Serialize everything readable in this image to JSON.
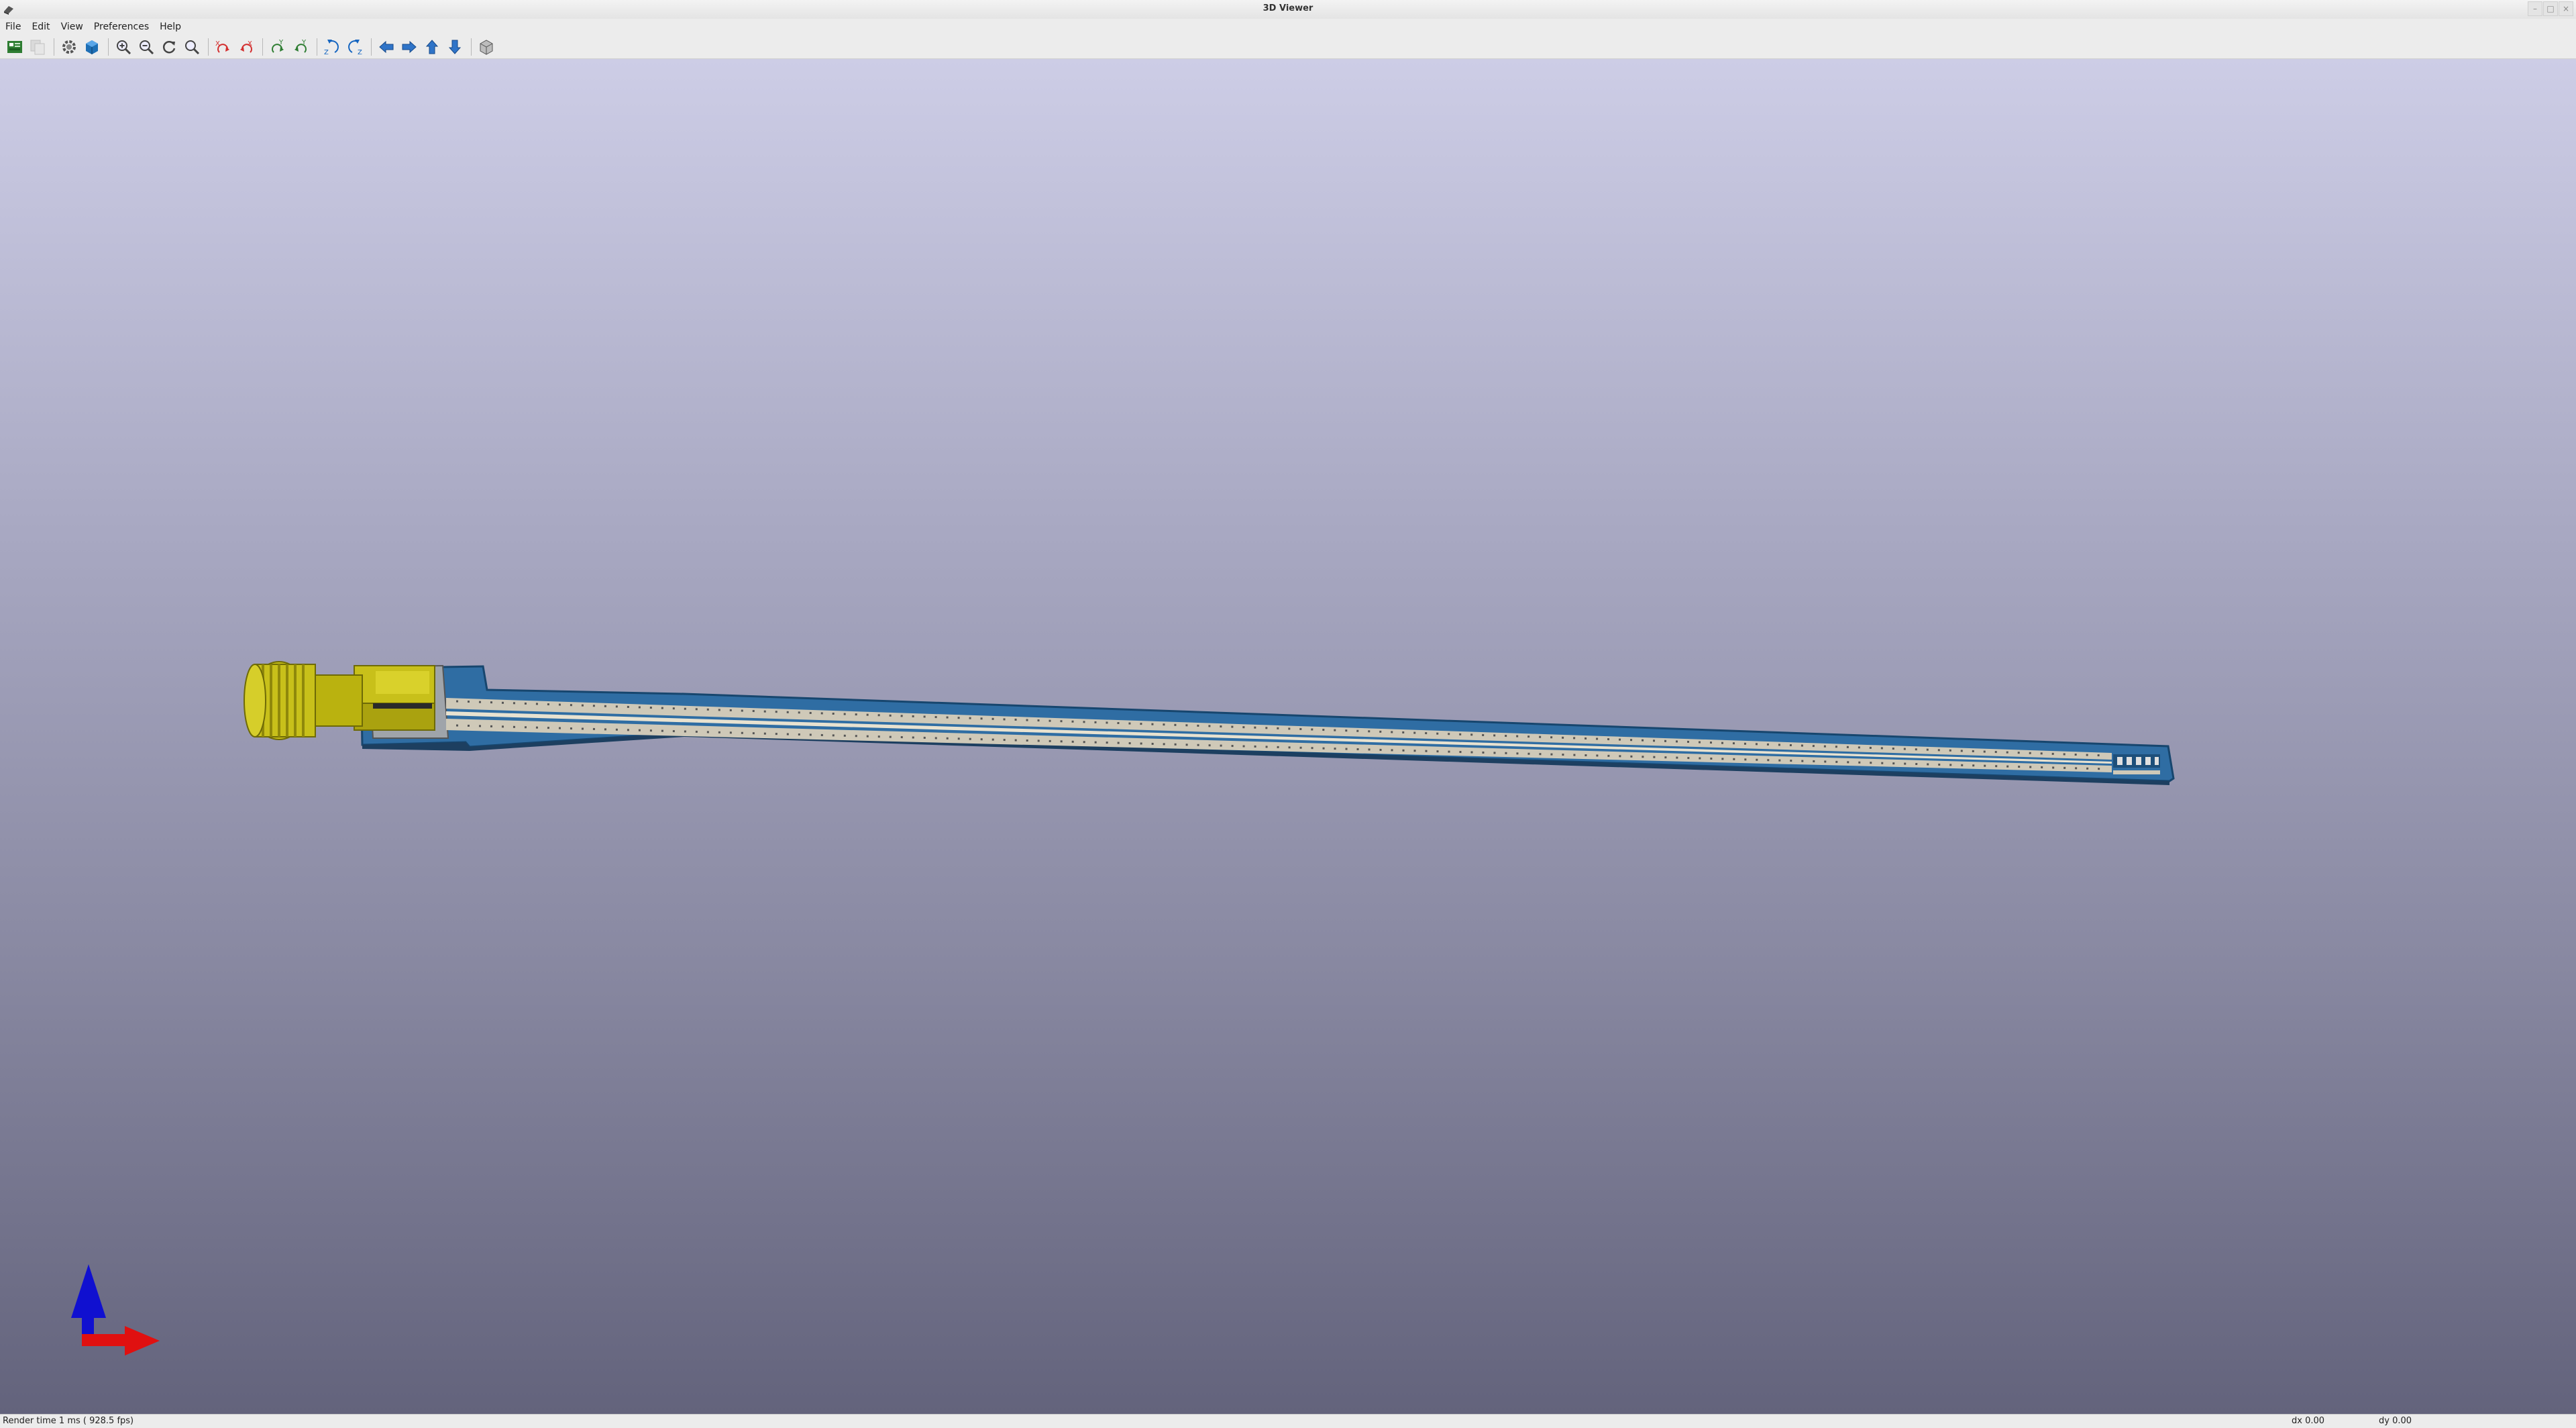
{
  "window": {
    "title": "3D Viewer"
  },
  "menu": {
    "items": [
      "File",
      "Edit",
      "View",
      "Preferences",
      "Help"
    ]
  },
  "toolbar": {
    "buttons": [
      {
        "name": "reload-board-button",
        "icon": "pcb-reload-icon"
      },
      {
        "name": "copy-image-button",
        "icon": "copy-icon"
      },
      {
        "name": "settings-button",
        "icon": "gear-icon"
      },
      {
        "name": "raytracing-toggle-button",
        "icon": "render-cube-icon"
      },
      {
        "name": "zoom-in-button",
        "icon": "zoom-in-icon"
      },
      {
        "name": "zoom-out-button",
        "icon": "zoom-out-icon"
      },
      {
        "name": "redraw-button",
        "icon": "refresh-icon"
      },
      {
        "name": "zoom-fit-button",
        "icon": "zoom-fit-icon"
      },
      {
        "name": "rotate-x-cw-button",
        "icon": "rotate-x-cw-icon"
      },
      {
        "name": "rotate-x-ccw-button",
        "icon": "rotate-x-ccw-icon"
      },
      {
        "name": "rotate-y-cw-button",
        "icon": "rotate-y-cw-icon"
      },
      {
        "name": "rotate-y-ccw-button",
        "icon": "rotate-y-ccw-icon"
      },
      {
        "name": "rotate-z-cw-button",
        "icon": "rotate-z-cw-icon"
      },
      {
        "name": "rotate-z-ccw-button",
        "icon": "rotate-z-ccw-icon"
      },
      {
        "name": "move-left-button",
        "icon": "arrow-left-icon"
      },
      {
        "name": "move-right-button",
        "icon": "arrow-right-icon"
      },
      {
        "name": "move-up-button",
        "icon": "arrow-up-icon"
      },
      {
        "name": "move-down-button",
        "icon": "arrow-down-icon"
      },
      {
        "name": "ortho-view-button",
        "icon": "ortho-cube-icon"
      }
    ]
  },
  "status": {
    "message": "Render time 1 ms ( 928.5 fps)",
    "dx": "dx 0.00",
    "dy": "dy 0.00"
  },
  "colors": {
    "board": "#2f6da3",
    "board_edge": "#1d4f7a",
    "trace": "#cfc9b8",
    "connector": "#c8c01a",
    "axis_x": "#e01010",
    "axis_z": "#1010d0"
  }
}
